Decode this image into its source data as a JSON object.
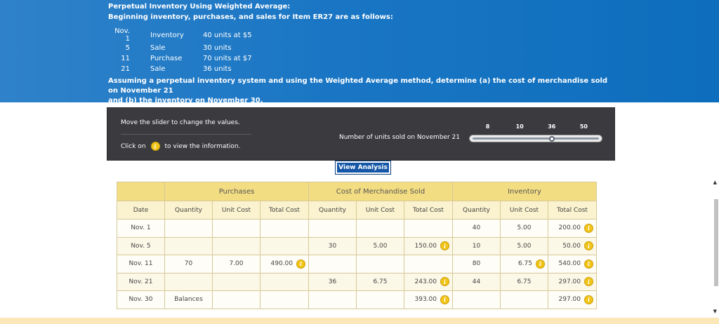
{
  "header": {
    "title": "Perpetual Inventory Using Weighted Average:",
    "subtitle": "Beginning inventory, purchases, and sales for Item ER27 are as follows:",
    "transactions": [
      {
        "date": "Nov. 1",
        "type": "Inventory",
        "desc": "40 units at $5"
      },
      {
        "date": "5",
        "type": "Sale",
        "desc": "30 units"
      },
      {
        "date": "11",
        "type": "Purchase",
        "desc": "70 units at $7"
      },
      {
        "date": "21",
        "type": "Sale",
        "desc": "36 units"
      }
    ],
    "question_line1": "Assuming a perpetual inventory system and using the Weighted Average method, determine (a) the cost of merchandise sold on November 21",
    "question_line2": "and (b) the inventory on November 30."
  },
  "panel": {
    "move_text": "Move the slider to change the values.",
    "click_before": "Click on",
    "click_after": "to view the information.",
    "info_glyph": "i",
    "slider_label": "Number of units sold on November 21",
    "slider_min": 8,
    "slider_max": 50,
    "slider_value": 36,
    "ticks": [
      "8",
      "10",
      "36",
      "50"
    ]
  },
  "button": {
    "label": "View Analysis"
  },
  "table": {
    "groups": [
      "Purchases",
      "Cost of Merchandise Sold",
      "Inventory"
    ],
    "columns": [
      "Date",
      "Quantity",
      "Unit Cost",
      "Total Cost",
      "Quantity",
      "Unit Cost",
      "Total Cost",
      "Quantity",
      "Unit Cost",
      "Total Cost"
    ],
    "rows": [
      {
        "date": "Nov. 1",
        "p_qty": "",
        "p_unit": "",
        "p_total": "",
        "c_qty": "",
        "c_unit": "",
        "c_total": "",
        "i_qty": "40",
        "i_unit": "5.00",
        "i_total": "200.00"
      },
      {
        "date": "Nov. 5",
        "p_qty": "",
        "p_unit": "",
        "p_total": "",
        "c_qty": "30",
        "c_unit": "5.00",
        "c_total": "150.00",
        "i_qty": "10",
        "i_unit": "5.00",
        "i_total": "50.00"
      },
      {
        "date": "Nov. 11",
        "p_qty": "70",
        "p_unit": "7.00",
        "p_total": "490.00",
        "c_qty": "",
        "c_unit": "",
        "c_total": "",
        "i_qty": "80",
        "i_unit": "6.75",
        "i_total": "540.00"
      },
      {
        "date": "Nov. 21",
        "p_qty": "",
        "p_unit": "",
        "p_total": "",
        "c_qty": "36",
        "c_unit": "6.75",
        "c_total": "243.00",
        "i_qty": "44",
        "i_unit": "6.75",
        "i_total": "297.00"
      },
      {
        "date": "Nov. 30",
        "p_qty": "Balances",
        "p_unit": "",
        "p_total": "",
        "c_qty": "",
        "c_unit": "",
        "c_total": "393.00",
        "i_qty": "",
        "i_unit": "",
        "i_total": "297.00"
      }
    ]
  },
  "colors": {
    "header_blue": "#1a76c4",
    "panel_dark": "#3a3a3f",
    "button_blue": "#1557a7",
    "group_header": "#f3dd82",
    "col_header": "#fbf3cf",
    "info_yellow": "#f3c418"
  }
}
